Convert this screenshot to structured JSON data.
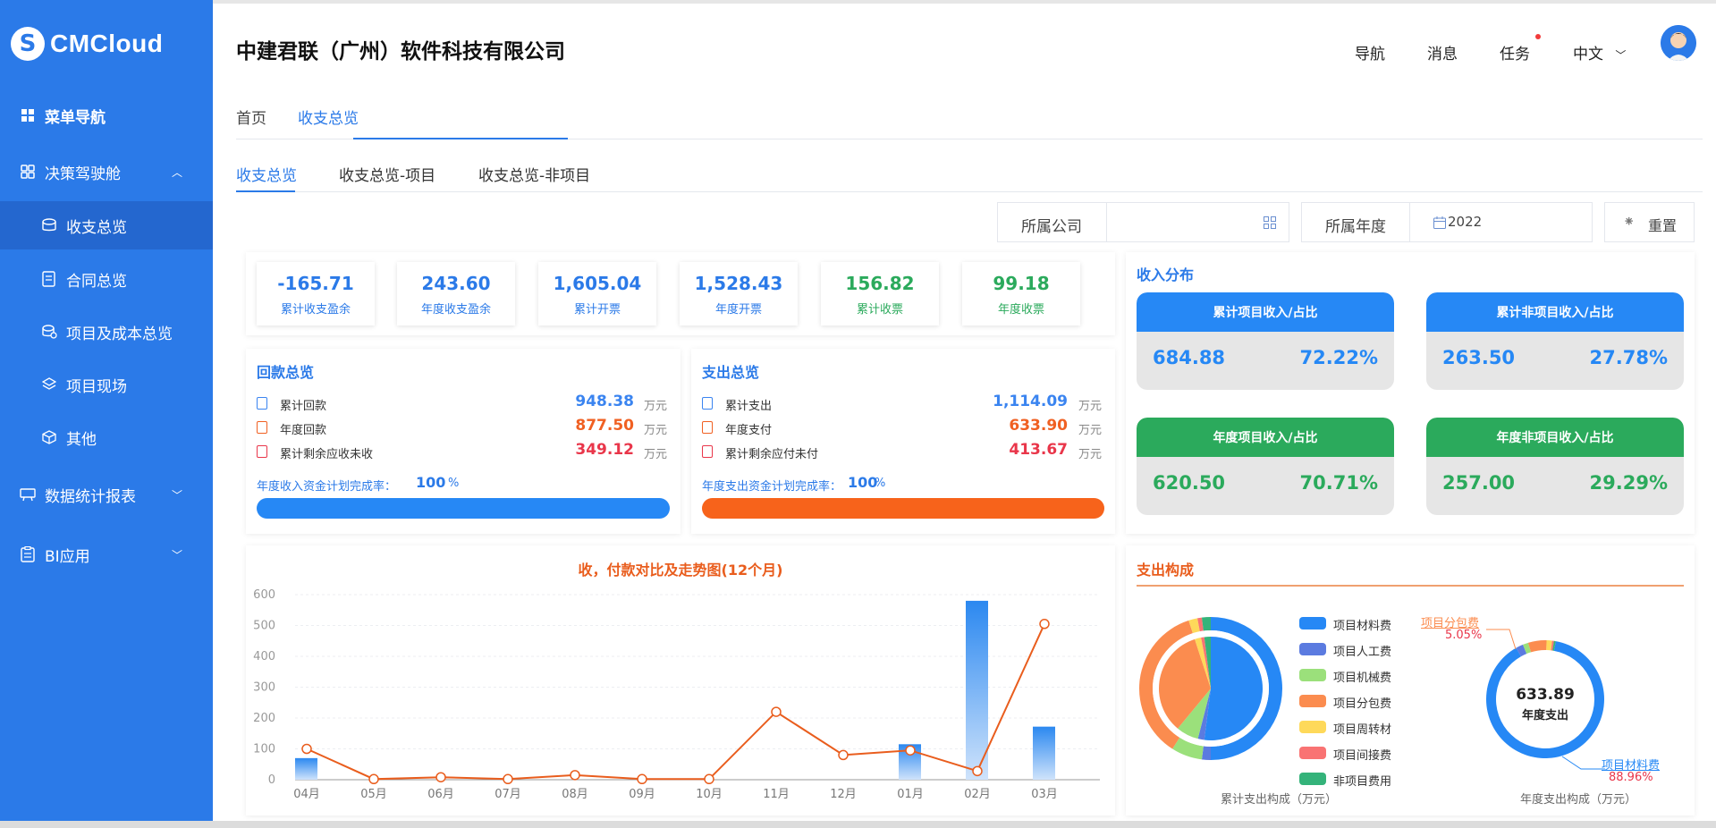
{
  "brand": {
    "logo_text": "CMCloud",
    "logo_glyph": "S"
  },
  "header": {
    "company": "中建君联（广州）软件科技有限公司",
    "nav": "导航",
    "messages": "消息",
    "tasks": "任务",
    "language": "中文"
  },
  "sidebar": {
    "items": [
      {
        "label": "菜单导航",
        "icon": "grid-icon"
      },
      {
        "label": "决策驾驶舱",
        "icon": "apps-icon"
      },
      {
        "label": "收支总览",
        "icon": "coins-icon"
      },
      {
        "label": "合同总览",
        "icon": "contract-icon"
      },
      {
        "label": "项目及成本总览",
        "icon": "project-cost-icon"
      },
      {
        "label": "项目现场",
        "icon": "layers-icon"
      },
      {
        "label": "其他",
        "icon": "cube-icon"
      },
      {
        "label": "数据统计报表",
        "icon": "report-icon"
      },
      {
        "label": "BI应用",
        "icon": "clipboard-icon"
      }
    ]
  },
  "tabs": {
    "home": "首页",
    "current": "收支总览"
  },
  "subtabs": [
    "收支总览",
    "收支总览-项目",
    "收支总览-非项目"
  ],
  "filters": {
    "company_label": "所属公司",
    "company_value": "",
    "year_label": "所属年度",
    "year_value": "2022",
    "reset": "重置"
  },
  "kpis": [
    {
      "value": "-165.71",
      "label": "累计收支盈余",
      "color": "#2b7ae8"
    },
    {
      "value": "243.60",
      "label": "年度收支盈余",
      "color": "#2b7ae8"
    },
    {
      "value": "1,605.04",
      "label": "累计开票",
      "color": "#2b7ae8"
    },
    {
      "value": "1,528.43",
      "label": "年度开票",
      "color": "#2b7ae8"
    },
    {
      "value": "156.82",
      "label": "累计收票",
      "color": "#2baa5c"
    },
    {
      "value": "99.18",
      "label": "年度收票",
      "color": "#2baa5c"
    }
  ],
  "receipts": {
    "title": "回款总览",
    "rows": [
      {
        "label": "累计回款",
        "value": "948.38",
        "unit": "万元",
        "color": "#3a84f0"
      },
      {
        "label": "年度回款",
        "value": "877.50",
        "unit": "万元",
        "color": "#f06022"
      },
      {
        "label": "累计剩余应收未收",
        "value": "349.12",
        "unit": "万元",
        "color": "#e9364a"
      }
    ],
    "rate_label": "年度收入资金计划完成率：",
    "rate_value": "100",
    "rate_unit": "%",
    "progress": 1.0,
    "bar_color": "#2688f5"
  },
  "expenses": {
    "title": "支出总览",
    "rows": [
      {
        "label": "累计支出",
        "value": "1,114.09",
        "unit": "万元",
        "color": "#3a84f0"
      },
      {
        "label": "年度支付",
        "value": "633.90",
        "unit": "万元",
        "color": "#f06022"
      },
      {
        "label": "累计剩余应付未付",
        "value": "413.67",
        "unit": "万元",
        "color": "#e9364a"
      }
    ],
    "rate_label": "年度支出资金计划完成率：",
    "rate_value": "100",
    "rate_unit": "%",
    "progress": 1.0,
    "bar_color": "#f7631b"
  },
  "income_dist": {
    "title": "收入分布",
    "boxes": [
      {
        "head": "累计项目收入/占比",
        "value": "684.88",
        "pct": "72.22%",
        "color": "#2688f5"
      },
      {
        "head": "累计非项目收入/占比",
        "value": "263.50",
        "pct": "27.78%",
        "color": "#2688f5"
      },
      {
        "head": "年度项目收入/占比",
        "value": "620.50",
        "pct": "70.71%",
        "color": "#2baa5c"
      },
      {
        "head": "年度非项目收入/占比",
        "value": "257.00",
        "pct": "29.29%",
        "color": "#2baa5c"
      }
    ]
  },
  "chart_data": [
    {
      "type": "bar",
      "title": "收，付款对比及走势图(12个月)",
      "categories": [
        "04月",
        "05月",
        "06月",
        "07月",
        "08月",
        "09月",
        "10月",
        "11月",
        "12月",
        "01月",
        "02月",
        "03月"
      ],
      "yticks": [
        0,
        100,
        200,
        300,
        400,
        500,
        600
      ],
      "ylim": [
        0,
        600
      ],
      "series": [
        {
          "values": [
            70,
            0,
            0,
            0,
            0,
            0,
            0,
            0,
            0,
            115,
            580,
            172
          ],
          "color": "#2b88f0"
        },
        {
          "values": [
            100,
            2,
            8,
            2,
            15,
            2,
            2,
            220,
            80,
            95,
            28,
            505
          ],
          "color": "#e95d1d"
        }
      ]
    },
    {
      "type": "pie",
      "legend": [
        "项目材料费",
        "项目人工费",
        "项目机械费",
        "项目分包费",
        "项目周转材",
        "项目间接费",
        "非项目费用"
      ],
      "colors": [
        "#2688f5",
        "#5b7be0",
        "#9be07b",
        "#fb8c4f",
        "#fed95a",
        "#f97373",
        "#34b37a"
      ],
      "outer_values": [
        50,
        2,
        7,
        36,
        2,
        1,
        2
      ],
      "inner_values": [
        52,
        2,
        7,
        34,
        2,
        1,
        2
      ],
      "caption": "累计支出构成（万元）"
    },
    {
      "type": "pie",
      "center_value": "633.89",
      "center_label": "年度支出",
      "caption": "年度支出构成（万元）",
      "values": [
        88.96,
        2,
        1.5,
        5.05,
        1.5,
        0.5,
        0.49
      ],
      "colors": [
        "#2688f5",
        "#5b7be0",
        "#9be07b",
        "#fb8c4f",
        "#fed95a",
        "#f97373",
        "#34b37a"
      ],
      "annotations": [
        {
          "label": "项目分包费",
          "pct": "5.05%",
          "color": "#fb8c4f"
        },
        {
          "label": "项目材料费",
          "pct": "88.96%",
          "color": "#2688f5"
        }
      ]
    }
  ],
  "expense_comp": {
    "title": "支出构成"
  }
}
